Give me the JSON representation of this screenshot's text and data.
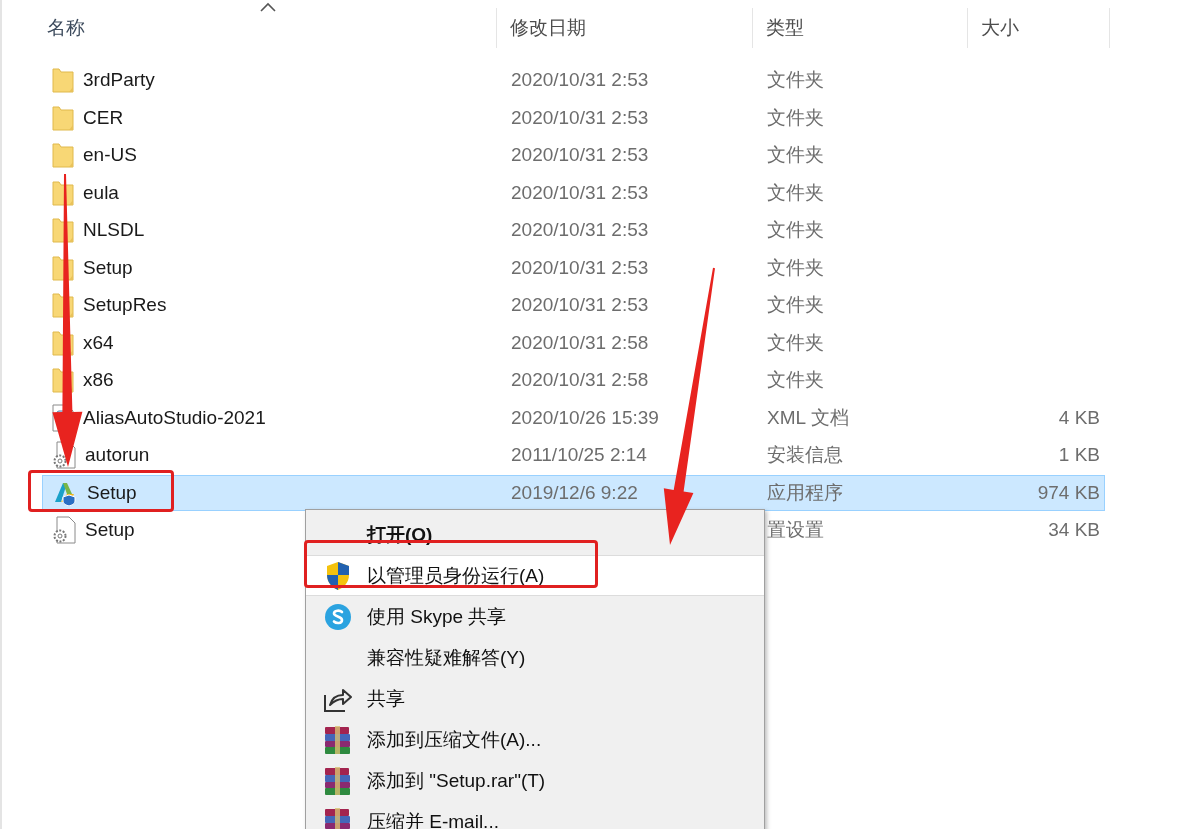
{
  "columns": [
    {
      "label": "名称",
      "sorted": true
    },
    {
      "label": "修改日期",
      "sorted": false
    },
    {
      "label": "类型",
      "sorted": false
    },
    {
      "label": "大小",
      "sorted": false
    }
  ],
  "files": [
    {
      "name": "3rdParty",
      "date": "2020/10/31 2:53",
      "type": "文件夹",
      "kind": "folder",
      "selected": false
    },
    {
      "name": "CER",
      "date": "2020/10/31 2:53",
      "type": "文件夹",
      "kind": "folder",
      "selected": false
    },
    {
      "name": "en-US",
      "date": "2020/10/31 2:53",
      "type": "文件夹",
      "kind": "folder",
      "selected": false
    },
    {
      "name": "eula",
      "date": "2020/10/31 2:53",
      "type": "文件夹",
      "kind": "folder",
      "selected": false
    },
    {
      "name": "NLSDL",
      "date": "2020/10/31 2:53",
      "type": "文件夹",
      "kind": "folder",
      "selected": false
    },
    {
      "name": "Setup",
      "date": "2020/10/31 2:53",
      "type": "文件夹",
      "kind": "folder",
      "selected": false
    },
    {
      "name": "SetupRes",
      "date": "2020/10/31 2:53",
      "type": "文件夹",
      "kind": "folder",
      "selected": false
    },
    {
      "name": "x64",
      "date": "2020/10/31 2:58",
      "type": "文件夹",
      "kind": "folder",
      "selected": false
    },
    {
      "name": "x86",
      "date": "2020/10/31 2:58",
      "type": "文件夹",
      "kind": "folder",
      "selected": false
    },
    {
      "name": "AliasAutoStudio-2021",
      "date": "2020/10/26 15:39",
      "type": "XML 文档",
      "size": "4 KB",
      "kind": "xml",
      "selected": false
    },
    {
      "name": "autorun",
      "date": "2011/10/25 2:14",
      "type": "安装信息",
      "size": "1 KB",
      "kind": "config",
      "selected": false
    },
    {
      "name": "Setup",
      "date": "2019/12/6 9:22",
      "type": "应用程序",
      "size": "974 KB",
      "kind": "app",
      "selected": true
    },
    {
      "name": "Setup",
      "type": "置设置",
      "size": "34 KB",
      "kind": "config",
      "selected": false
    }
  ],
  "context_menu": [
    {
      "label": "打开(O)",
      "default": true,
      "selected": false
    },
    {
      "label": "以管理员身份运行(A)",
      "kind": "shield",
      "default": false,
      "selected": true
    },
    {
      "label": "使用 Skype 共享",
      "kind": "skype",
      "default": false,
      "selected": false
    },
    {
      "label": "兼容性疑难解答(Y)",
      "default": false,
      "selected": false
    },
    {
      "label": "共享",
      "kind": "share",
      "default": false,
      "selected": false
    },
    {
      "label": "添加到压缩文件(A)...",
      "kind": "archive",
      "default": false,
      "selected": false
    },
    {
      "label": "添加到 \"Setup.rar\"(T)",
      "kind": "archive",
      "default": false,
      "selected": false
    },
    {
      "label": "压缩并 E-mail...",
      "kind": "archive",
      "default": false,
      "selected": false
    }
  ]
}
